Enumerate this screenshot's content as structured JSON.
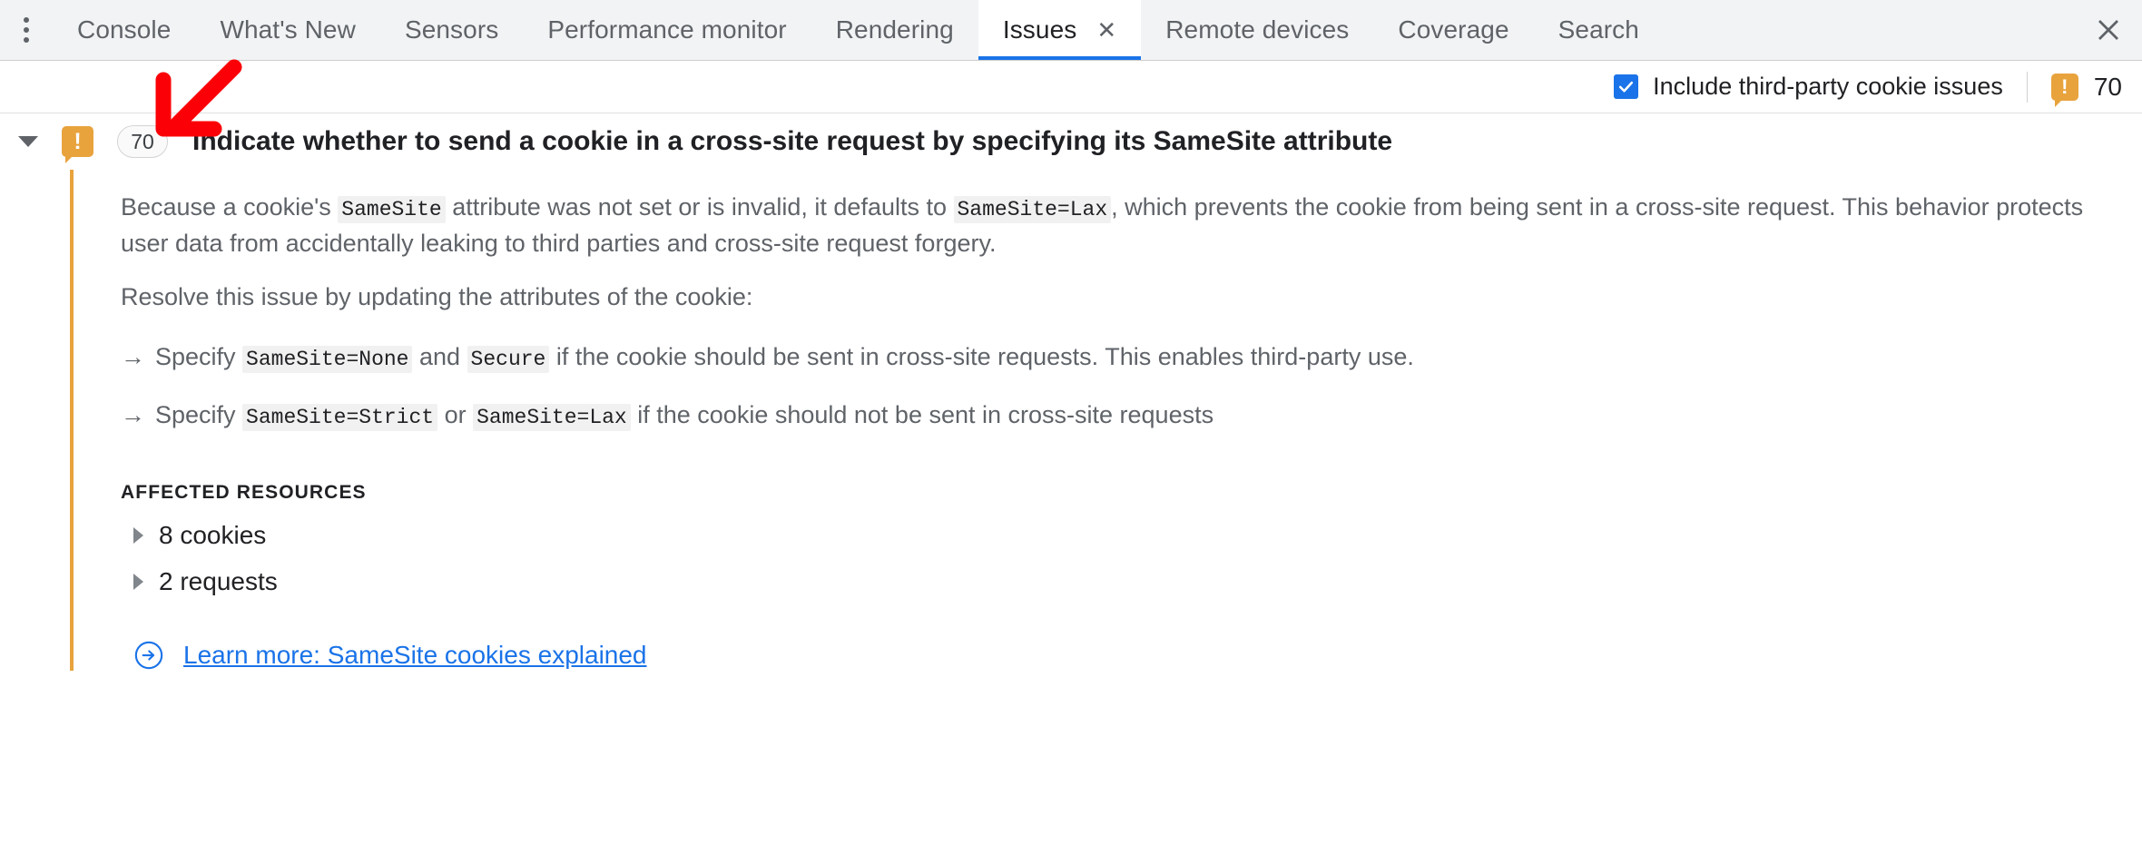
{
  "tabbar": {
    "more_icon": "overflow-menu-icon",
    "close_icon": "close-icon",
    "tabs": [
      {
        "label": "Console",
        "active": false
      },
      {
        "label": "What's New",
        "active": false
      },
      {
        "label": "Sensors",
        "active": false
      },
      {
        "label": "Performance monitor",
        "active": false
      },
      {
        "label": "Rendering",
        "active": false
      },
      {
        "label": "Issues",
        "active": true,
        "close_glyph": "✕"
      },
      {
        "label": "Remote devices",
        "active": false
      },
      {
        "label": "Coverage",
        "active": false
      },
      {
        "label": "Search",
        "active": false
      }
    ]
  },
  "toolbar": {
    "checkbox_label": "Include third-party cookie issues",
    "checkbox_checked": true,
    "warning_glyph": "!",
    "warning_count": "70",
    "accent_color": "#1a73e8",
    "warning_color": "#e8a33d"
  },
  "issue": {
    "expanded": true,
    "caret_icon": "chevron-down-icon",
    "icon_name": "warning-icon",
    "warning_glyph": "!",
    "count_badge": "70",
    "title": "Indicate whether to send a cookie in a cross-site request by specifying its SameSite attribute",
    "paragraph1": {
      "part1": "Because a cookie's ",
      "code1": "SameSite",
      "part2": " attribute was not set or is invalid, it defaults to ",
      "code2": "SameSite=Lax",
      "part3": ", which prevents the cookie from being sent in a cross-site request. This behavior protects user data from accidentally leaking to third parties and cross-site request forgery."
    },
    "paragraph2": "Resolve this issue by updating the attributes of the cookie:",
    "fix_arrow_glyph": "→",
    "fixes": [
      {
        "part1": "Specify ",
        "code1": "SameSite=None",
        "part2": " and ",
        "code2": "Secure",
        "part3": " if the cookie should be sent in cross-site requests. This enables third-party use."
      },
      {
        "part1": "Specify ",
        "code1": "SameSite=Strict",
        "part2": " or ",
        "code2": "SameSite=Lax",
        "part3": " if the cookie should not be sent in cross-site requests"
      }
    ],
    "affected_resources_title": "AFFECTED RESOURCES",
    "resources": [
      {
        "label": "8 cookies",
        "caret_icon": "chevron-right-icon"
      },
      {
        "label": "2 requests",
        "caret_icon": "chevron-right-icon"
      }
    ],
    "learn_more": {
      "icon": "arrow-circle-right-icon",
      "label": "Learn more: SameSite cookies explained"
    },
    "stripe_color": "#e8a33d"
  },
  "annotation": {
    "arrow_icon": "red-arrow-down-left",
    "color": "#fb0007"
  }
}
